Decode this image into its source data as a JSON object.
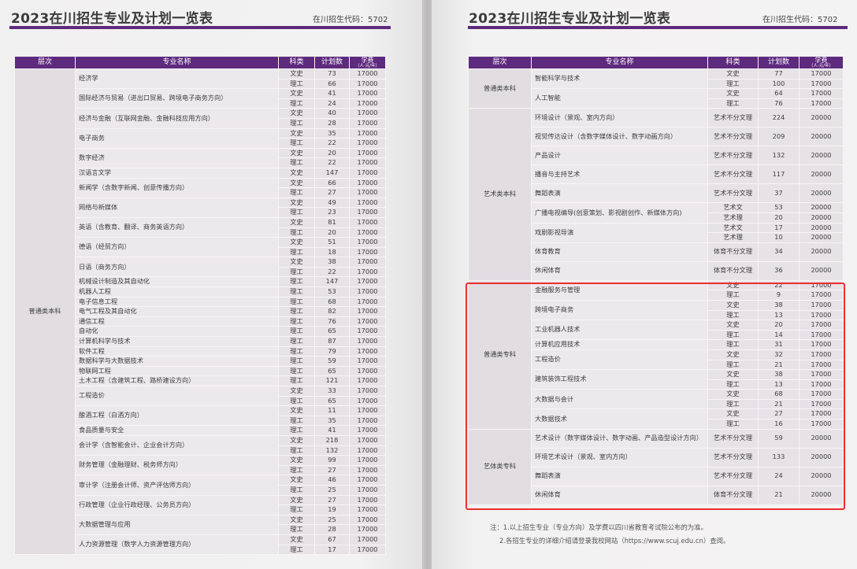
{
  "title": "2023在川招生专业及计划一览表",
  "code_text": "在川招生代码：5702",
  "columns": {
    "level": "层次",
    "major": "专业名称",
    "category": "科类",
    "plan": "计划数",
    "fee": "学费",
    "fee_sub": "（人·元/年）"
  },
  "left_table": [
    {
      "level": "普通类本科",
      "majors": [
        {
          "name": "经济学",
          "rows": [
            [
              "文史",
              "73",
              "17000"
            ],
            [
              "理工",
              "66",
              "17000"
            ]
          ]
        },
        {
          "name": "国际经济与贸易（进出口贸易、跨境电子商务方向）",
          "rows": [
            [
              "文史",
              "41",
              "17000"
            ],
            [
              "理工",
              "24",
              "17000"
            ]
          ]
        },
        {
          "name": "经济与金融（互联网金融、金融科技应用方向）",
          "rows": [
            [
              "文史",
              "40",
              "17000"
            ],
            [
              "理工",
              "28",
              "17000"
            ]
          ]
        },
        {
          "name": "电子商务",
          "rows": [
            [
              "文史",
              "35",
              "17000"
            ],
            [
              "理工",
              "22",
              "17000"
            ]
          ]
        },
        {
          "name": "数字经济",
          "rows": [
            [
              "文史",
              "20",
              "17000"
            ],
            [
              "理工",
              "22",
              "17000"
            ]
          ]
        },
        {
          "name": "汉语言文学",
          "rows": [
            [
              "文史",
              "147",
              "17000"
            ]
          ]
        },
        {
          "name": "新闻学（含数字新闻、创意传播方向）",
          "rows": [
            [
              "文史",
              "66",
              "17000"
            ],
            [
              "理工",
              "27",
              "17000"
            ]
          ]
        },
        {
          "name": "网络与新媒体",
          "rows": [
            [
              "文史",
              "49",
              "17000"
            ],
            [
              "理工",
              "23",
              "17000"
            ]
          ]
        },
        {
          "name": "英语（含教育、翻译、商务英语方向）",
          "rows": [
            [
              "文史",
              "81",
              "17000"
            ],
            [
              "理工",
              "20",
              "17000"
            ]
          ]
        },
        {
          "name": "德语（经贸方向）",
          "rows": [
            [
              "文史",
              "51",
              "17000"
            ],
            [
              "理工",
              "18",
              "17000"
            ]
          ]
        },
        {
          "name": "日语（商务方向）",
          "rows": [
            [
              "文史",
              "38",
              "17000"
            ],
            [
              "理工",
              "22",
              "17000"
            ]
          ]
        },
        {
          "name": "机械设计制造及其自动化",
          "rows": [
            [
              "理工",
              "147",
              "17000"
            ]
          ]
        },
        {
          "name": "机器人工程",
          "rows": [
            [
              "理工",
              "53",
              "17000"
            ]
          ]
        },
        {
          "name": "电子信息工程",
          "rows": [
            [
              "理工",
              "68",
              "17000"
            ]
          ]
        },
        {
          "name": "电气工程及其自动化",
          "rows": [
            [
              "理工",
              "82",
              "17000"
            ]
          ]
        },
        {
          "name": "通信工程",
          "rows": [
            [
              "理工",
              "76",
              "17000"
            ]
          ]
        },
        {
          "name": "自动化",
          "rows": [
            [
              "理工",
              "65",
              "17000"
            ]
          ]
        },
        {
          "name": "计算机科学与技术",
          "rows": [
            [
              "理工",
              "87",
              "17000"
            ]
          ]
        },
        {
          "name": "软件工程",
          "rows": [
            [
              "理工",
              "79",
              "17000"
            ]
          ]
        },
        {
          "name": "数据科学与大数据技术",
          "rows": [
            [
              "理工",
              "59",
              "17000"
            ]
          ]
        },
        {
          "name": "物联网工程",
          "rows": [
            [
              "理工",
              "65",
              "17000"
            ]
          ]
        },
        {
          "name": "土木工程（含建筑工程、路桥建设方向）",
          "rows": [
            [
              "理工",
              "121",
              "17000"
            ]
          ]
        },
        {
          "name": "工程造价",
          "rows": [
            [
              "文史",
              "33",
              "17000"
            ],
            [
              "理工",
              "65",
              "17000"
            ]
          ]
        },
        {
          "name": "酿酒工程（白酒方向）",
          "rows": [
            [
              "文史",
              "11",
              "17000"
            ],
            [
              "理工",
              "35",
              "17000"
            ]
          ]
        },
        {
          "name": "食品质量与安全",
          "rows": [
            [
              "理工",
              "41",
              "17000"
            ]
          ]
        },
        {
          "name": "会计学（含智能会计、企业会计方向）",
          "rows": [
            [
              "文史",
              "218",
              "17000"
            ],
            [
              "理工",
              "132",
              "17000"
            ]
          ]
        },
        {
          "name": "财务管理（金融理财、税务师方向）",
          "rows": [
            [
              "文史",
              "99",
              "17000"
            ],
            [
              "理工",
              "27",
              "17000"
            ]
          ]
        },
        {
          "name": "审计学（注册会计师、资产评估师方向）",
          "rows": [
            [
              "文史",
              "46",
              "17000"
            ],
            [
              "理工",
              "25",
              "17000"
            ]
          ]
        },
        {
          "name": "行政管理（企业行政经理、公务员方向）",
          "rows": [
            [
              "文史",
              "27",
              "17000"
            ],
            [
              "理工",
              "19",
              "17000"
            ]
          ]
        },
        {
          "name": "大数据管理与应用",
          "rows": [
            [
              "文史",
              "25",
              "17000"
            ],
            [
              "理工",
              "28",
              "17000"
            ]
          ]
        },
        {
          "name": "人力资源管理（数字人力资源管理方向）",
          "rows": [
            [
              "文史",
              "67",
              "17000"
            ],
            [
              "理工",
              "17",
              "17000"
            ]
          ]
        }
      ]
    }
  ],
  "right_table": [
    {
      "level": "普通类本科",
      "majors": [
        {
          "name": "智能科学与技术",
          "rows": [
            [
              "文史",
              "77",
              "17000"
            ],
            [
              "理工",
              "100",
              "17000"
            ]
          ]
        },
        {
          "name": "人工智能",
          "rows": [
            [
              "文史",
              "64",
              "17000"
            ],
            [
              "理工",
              "76",
              "17000"
            ]
          ]
        }
      ]
    },
    {
      "level": "艺术类本科",
      "majors": [
        {
          "name": "环境设计（景观、室内方向）",
          "rows": [
            [
              "艺术不分文理",
              "224",
              "20000"
            ]
          ]
        },
        {
          "name": "视觉传达设计（含数字媒体设计、数字动画方向）",
          "rows": [
            [
              "艺术不分文理",
              "209",
              "20000"
            ]
          ]
        },
        {
          "name": "产品设计",
          "rows": [
            [
              "艺术不分文理",
              "132",
              "20000"
            ]
          ]
        },
        {
          "name": "播音与主持艺术",
          "rows": [
            [
              "艺术不分文理",
              "117",
              "20000"
            ]
          ]
        },
        {
          "name": "舞蹈表演",
          "rows": [
            [
              "艺术不分文理",
              "37",
              "20000"
            ]
          ]
        },
        {
          "name": "广播电视编导(创意策划、影视剧创作、新媒体方向)",
          "rows": [
            [
              "艺术文",
              "53",
              "20000"
            ],
            [
              "艺术理",
              "20",
              "20000"
            ]
          ]
        },
        {
          "name": "戏剧影视导演",
          "rows": [
            [
              "艺术文",
              "17",
              "20000"
            ],
            [
              "艺术理",
              "10",
              "20000"
            ]
          ]
        },
        {
          "name": "体育教育",
          "rows": [
            [
              "体育不分文理",
              "34",
              "20000"
            ]
          ]
        },
        {
          "name": "休闲体育",
          "rows": [
            [
              "体育不分文理",
              "36",
              "20000"
            ]
          ]
        }
      ]
    },
    {
      "level": "普通类专科",
      "majors": [
        {
          "name": "金融服务与管理",
          "rows": [
            [
              "文史",
              "22",
              "17000"
            ],
            [
              "理工",
              "9",
              "17000"
            ]
          ]
        },
        {
          "name": "跨境电子商务",
          "rows": [
            [
              "文史",
              "38",
              "17000"
            ],
            [
              "理工",
              "13",
              "17000"
            ]
          ]
        },
        {
          "name": "工业机器人技术",
          "rows": [
            [
              "文史",
              "20",
              "17000"
            ],
            [
              "理工",
              "14",
              "17000"
            ]
          ]
        },
        {
          "name": "计算机应用技术",
          "rows": [
            [
              "理工",
              "31",
              "17000"
            ]
          ]
        },
        {
          "name": "工程造价",
          "rows": [
            [
              "文史",
              "32",
              "17000"
            ],
            [
              "理工",
              "21",
              "17000"
            ]
          ]
        },
        {
          "name": "建筑装饰工程技术",
          "rows": [
            [
              "文史",
              "38",
              "17000"
            ],
            [
              "理工",
              "13",
              "17000"
            ]
          ]
        },
        {
          "name": "大数据与会计",
          "rows": [
            [
              "文史",
              "68",
              "17000"
            ],
            [
              "理工",
              "21",
              "17000"
            ]
          ]
        },
        {
          "name": "大数据技术",
          "rows": [
            [
              "文史",
              "27",
              "17000"
            ],
            [
              "理工",
              "16",
              "17000"
            ]
          ]
        }
      ]
    },
    {
      "level": "艺体类专科",
      "majors": [
        {
          "name": "艺术设计（数字媒体设计、数字动画、产品造型设计方向）",
          "rows": [
            [
              "艺术不分文理",
              "59",
              "20000"
            ]
          ]
        },
        {
          "name": "环境艺术设计（景观、室内方向）",
          "rows": [
            [
              "艺术不分文理",
              "133",
              "20000"
            ]
          ]
        },
        {
          "name": "舞蹈表演",
          "rows": [
            [
              "艺术不分文理",
              "24",
              "20000"
            ]
          ]
        },
        {
          "name": "休闲体育",
          "rows": [
            [
              "体育不分文理",
              "21",
              "20000"
            ]
          ]
        }
      ]
    }
  ],
  "notes": [
    "注：1.以上招生专业（专业方向）及学费以四川省教育考试院公布的为准。",
    "2.各招生专业的详细介绍请登录我校网站（https://www.scuj.edu.cn）查阅。"
  ],
  "colors": {
    "header": "#5e2a7e",
    "highlight": "#ec2e2e"
  }
}
